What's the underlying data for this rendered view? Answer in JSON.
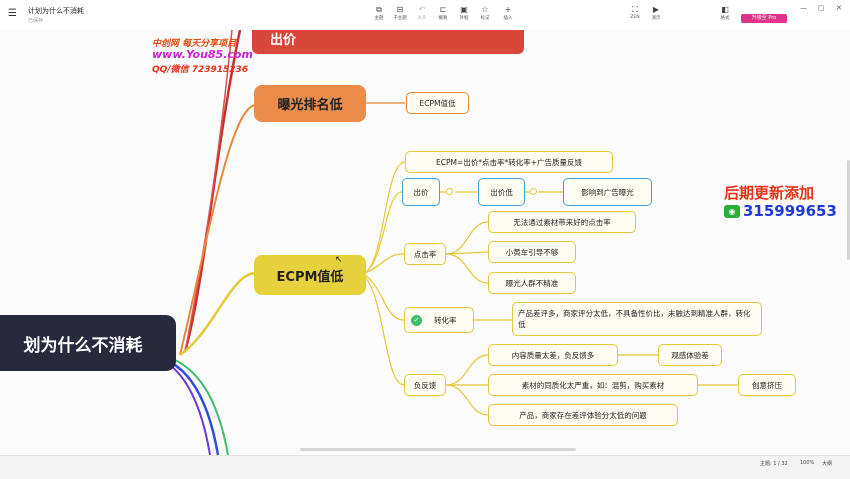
{
  "window": {
    "title": "计划为什么不消耗",
    "subtitle": "已保存"
  },
  "toolbar": {
    "items": [
      {
        "label": "主题",
        "icon": "theme-icon",
        "glyph": "⧉"
      },
      {
        "label": "子主题",
        "icon": "subtopic-icon",
        "glyph": "⊟"
      },
      {
        "label": "关系",
        "icon": "relation-icon",
        "glyph": "↶"
      },
      {
        "label": "概要",
        "icon": "summary-icon",
        "glyph": "⊏"
      },
      {
        "label": "外框",
        "icon": "frame-icon",
        "glyph": "▣"
      },
      {
        "label": "标记",
        "icon": "marker-icon",
        "glyph": "☆"
      },
      {
        "label": "插入",
        "icon": "insert-icon",
        "glyph": "+"
      }
    ],
    "right_items": [
      {
        "label": "ZEN",
        "icon": "zen-icon",
        "glyph": "⛶"
      },
      {
        "label": "演示",
        "icon": "present-icon",
        "glyph": "▶"
      },
      {
        "label": "格式",
        "icon": "format-icon",
        "glyph": "◧"
      }
    ],
    "pro_label": "升级至 Pro",
    "window_buttons": [
      "—",
      "▢",
      "✕"
    ]
  },
  "watermark": {
    "line1": "中创网 每天分享项目",
    "line2": "www.You85.com",
    "line3": "QQ/微信 723915236",
    "right_line1": "后期更新添加",
    "right_line2": "315999653"
  },
  "mindmap": {
    "central": "划为什么不消耗",
    "top_partial": "出价",
    "branch_exposure": {
      "title": "曝光排名低",
      "child": "ECPM值低"
    },
    "branch_ecpm": {
      "title": "ECPM值低",
      "formula": "ECPM=出价*点击率*转化率+广告质量反馈",
      "bid": {
        "label": "出价",
        "low": "出价低",
        "effect": "影响到广告曝光"
      },
      "ctr": {
        "label": "点击率",
        "children": [
          "无法通过素材带来好的点击率",
          "小黄车引导不够",
          "曝光人群不精准"
        ]
      },
      "cvr": {
        "label": "转化率",
        "child": "产品差评多，商家评分太低，不具备性价比，未触达到精准人群，转化低"
      },
      "feedback": {
        "label": "负反馈",
        "children": [
          {
            "text": "内容质量太差，负反馈多",
            "sub": "观感体验差"
          },
          {
            "text": "素材的同质化太严重，如：混剪，购买素材",
            "sub": "创意挤压"
          },
          {
            "text": "产品，商家存在差评体验分太低的问题",
            "sub": ""
          }
        ]
      }
    }
  },
  "status": {
    "topics": "主题: 1 / 32",
    "zoom": "100%",
    "size": "大纲"
  }
}
